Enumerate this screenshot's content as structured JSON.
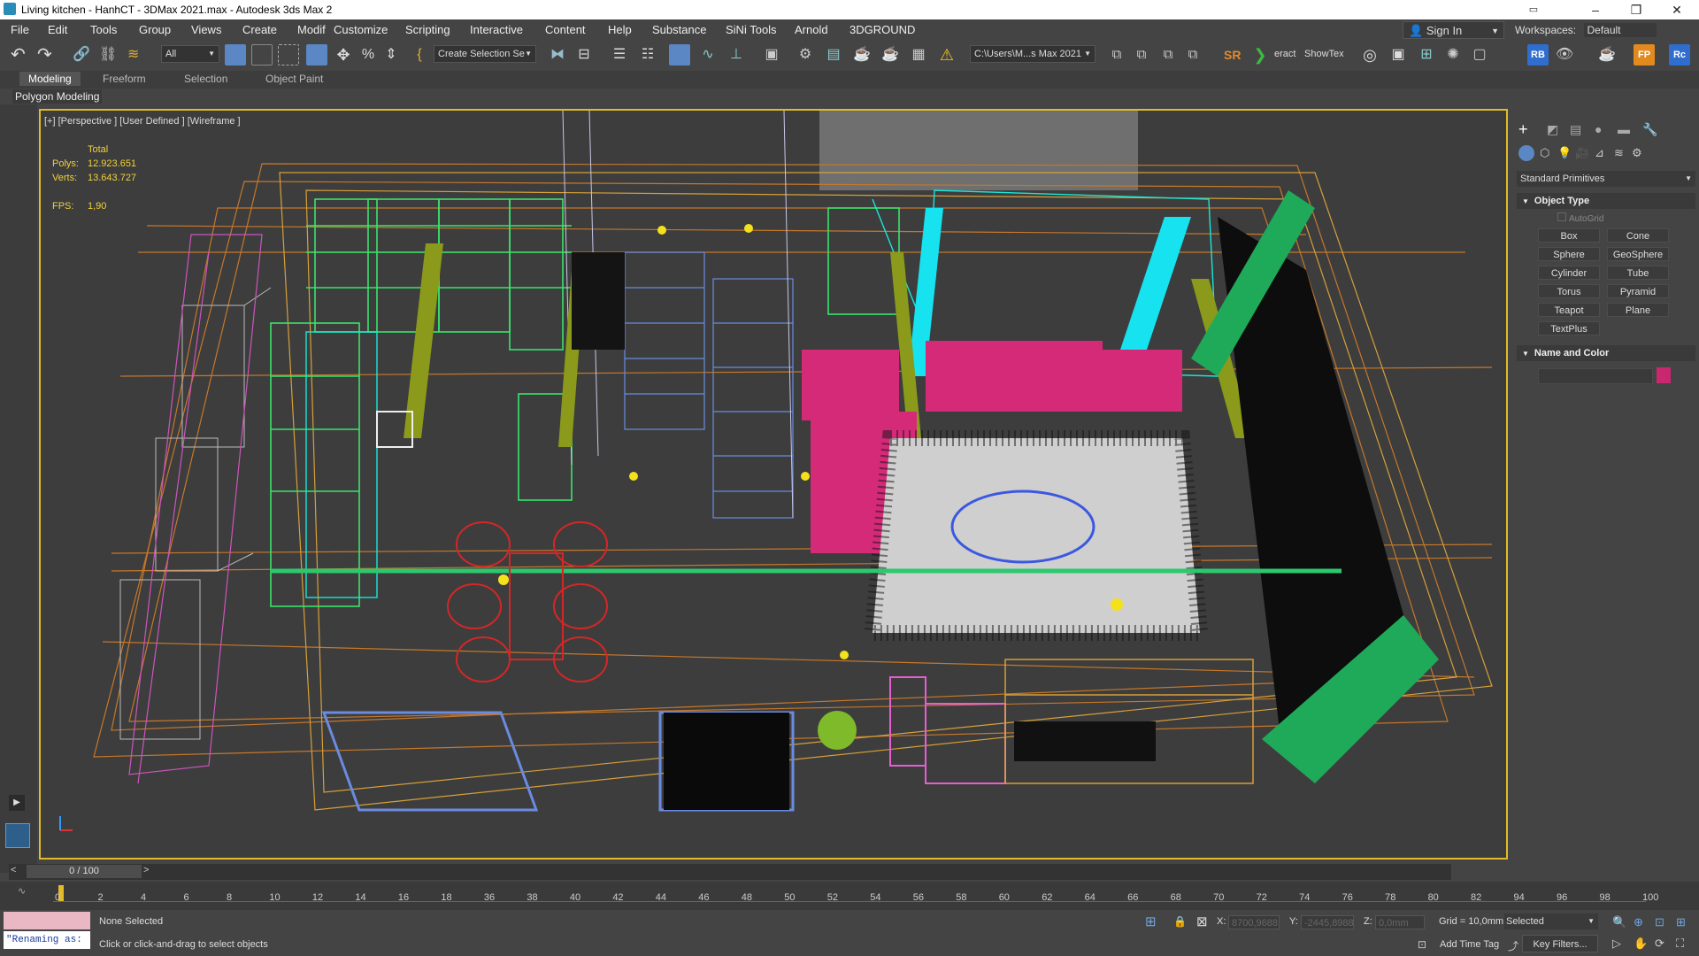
{
  "window": {
    "title": "Living kitchen - HanhCT - 3DMax 2021.max - Autodesk 3ds Max 2"
  },
  "menu": [
    "File",
    "Edit",
    "Tools",
    "Group",
    "Views",
    "Create",
    "Modif",
    "Customize",
    "Scripting",
    "Interactive",
    "Content",
    "Help",
    "Substance",
    "SiNi Tools",
    "Arnold",
    "3DGROUND"
  ],
  "account": {
    "sign_in": "Sign In",
    "workspaces_label": "Workspaces:",
    "workspace_value": "Default"
  },
  "toolbar": {
    "filter_value": "All",
    "selection_set": "Create Selection Se",
    "project_path": "C:\\Users\\M...s Max 2021",
    "sr_label": "SR",
    "interact_label": "eract",
    "showtex_label": "ShowTex",
    "rb_label": "RB",
    "fp_label": "FP",
    "rc_label": "Rc"
  },
  "ribbon": {
    "tabs": [
      "Modeling",
      "Freeform",
      "Selection",
      "Object Paint"
    ],
    "subpanel": "Polygon Modeling"
  },
  "viewport": {
    "label": "[+] [Perspective ] [User Defined ] [Wireframe ]",
    "stats_header": "Total",
    "polys_label": "Polys:",
    "polys_value": "12.923.651",
    "verts_label": "Verts:",
    "verts_value": "13.643.727",
    "fps_label": "FPS:",
    "fps_value": "1,90"
  },
  "command_panel": {
    "category": "Standard Primitives",
    "object_type_title": "Object Type",
    "autogrid": "AutoGrid",
    "buttons": [
      "Box",
      "Cone",
      "Sphere",
      "GeoSphere",
      "Cylinder",
      "Tube",
      "Torus",
      "Pyramid",
      "Teapot",
      "Plane",
      "TextPlus"
    ],
    "name_color_title": "Name and Color",
    "object_color": "#c9276f"
  },
  "timeline": {
    "frame_display": "0 / 100",
    "ticks": [
      "0",
      "2",
      "4",
      "6",
      "8",
      "10",
      "12",
      "14",
      "16",
      "18",
      "36",
      "38",
      "40",
      "42",
      "44",
      "46",
      "48",
      "50",
      "52",
      "54",
      "56",
      "58",
      "60",
      "62",
      "64",
      "66",
      "68",
      "70",
      "72",
      "74",
      "76",
      "78",
      "80",
      "82",
      "94",
      "96",
      "98",
      "100"
    ]
  },
  "status": {
    "script_text": "\"Renaming as:",
    "selection_text": "None Selected",
    "prompt": "Click or click-and-drag to select objects",
    "x_label": "X:",
    "x_value": "8700,9688",
    "y_label": "Y:",
    "y_value": "-2445,8988",
    "z_label": "Z:",
    "z_value": "0,0mm",
    "grid": "Grid = 10,0mm",
    "selected_dropdown": "Selected",
    "add_time_tag": "Add Time Tag",
    "key_filters": "Key Filters..."
  }
}
